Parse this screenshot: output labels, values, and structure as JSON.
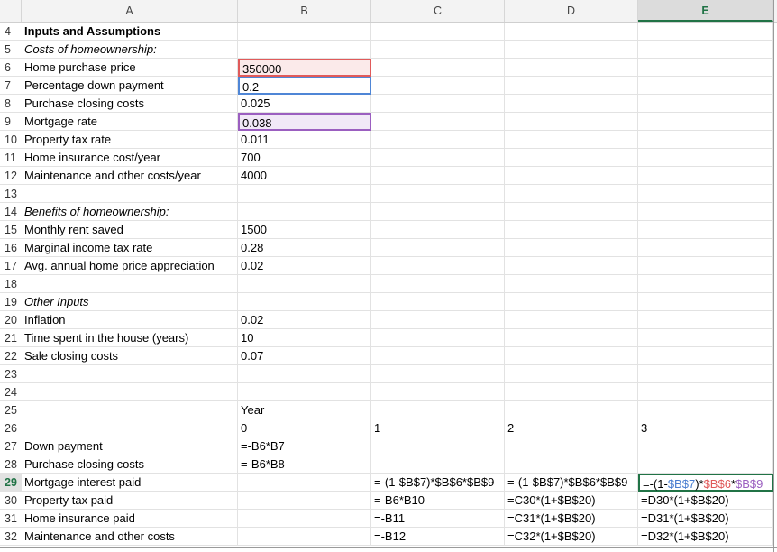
{
  "columns": [
    "A",
    "B",
    "C",
    "D",
    "E"
  ],
  "rows": [
    {
      "num": "4",
      "a": "Inputs and Assumptions",
      "a_style": "bold",
      "b": "",
      "c": "",
      "d": "",
      "e": ""
    },
    {
      "num": "5",
      "a": "Costs of homeownership:",
      "a_style": "ital",
      "b": "",
      "c": "",
      "d": "",
      "e": ""
    },
    {
      "num": "6",
      "a": "Home purchase price",
      "b": "350000",
      "c": "",
      "d": "",
      "e": ""
    },
    {
      "num": "7",
      "a": "Percentage down payment",
      "b": "0.2",
      "c": "",
      "d": "",
      "e": ""
    },
    {
      "num": "8",
      "a": "Purchase closing costs",
      "b": "0.025",
      "c": "",
      "d": "",
      "e": ""
    },
    {
      "num": "9",
      "a": "Mortgage rate",
      "b": "0.038",
      "c": "",
      "d": "",
      "e": ""
    },
    {
      "num": "10",
      "a": "Property tax rate",
      "b": "0.011",
      "c": "",
      "d": "",
      "e": ""
    },
    {
      "num": "11",
      "a": "Home insurance cost/year",
      "b": "700",
      "c": "",
      "d": "",
      "e": ""
    },
    {
      "num": "12",
      "a": "Maintenance and other costs/year",
      "b": "4000",
      "c": "",
      "d": "",
      "e": ""
    },
    {
      "num": "13",
      "a": "",
      "b": "",
      "c": "",
      "d": "",
      "e": ""
    },
    {
      "num": "14",
      "a": "Benefits of homeownership:",
      "a_style": "ital",
      "b": "",
      "c": "",
      "d": "",
      "e": ""
    },
    {
      "num": "15",
      "a": "Monthly rent saved",
      "b": "1500",
      "c": "",
      "d": "",
      "e": ""
    },
    {
      "num": "16",
      "a": "Marginal income tax rate",
      "b": "0.28",
      "c": "",
      "d": "",
      "e": ""
    },
    {
      "num": "17",
      "a": "Avg. annual home price appreciation",
      "b": "0.02",
      "c": "",
      "d": "",
      "e": ""
    },
    {
      "num": "18",
      "a": "",
      "b": "",
      "c": "",
      "d": "",
      "e": ""
    },
    {
      "num": "19",
      "a": "Other Inputs",
      "a_style": "ital",
      "b": "",
      "c": "",
      "d": "",
      "e": ""
    },
    {
      "num": "20",
      "a": "Inflation",
      "b": "0.02",
      "c": "",
      "d": "",
      "e": ""
    },
    {
      "num": "21",
      "a": "Time spent in the house (years)",
      "b": "10",
      "c": "",
      "d": "",
      "e": ""
    },
    {
      "num": "22",
      "a": "Sale closing costs",
      "b": "0.07",
      "c": "",
      "d": "",
      "e": ""
    },
    {
      "num": "23",
      "a": "",
      "b": "",
      "c": "",
      "d": "",
      "e": ""
    },
    {
      "num": "24",
      "a": "",
      "b": "",
      "c": "",
      "d": "",
      "e": ""
    },
    {
      "num": "25",
      "a": "",
      "b": "Year",
      "c": "",
      "d": "",
      "e": ""
    },
    {
      "num": "26",
      "a": "",
      "b": "0",
      "c": "1",
      "d": "2",
      "e": "3"
    },
    {
      "num": "27",
      "a": "Down payment",
      "b": "=-B6*B7",
      "c": "",
      "d": "",
      "e": ""
    },
    {
      "num": "28",
      "a": "Purchase closing costs",
      "b": "=-B6*B8",
      "c": "",
      "d": "",
      "e": ""
    },
    {
      "num": "29",
      "a": "Mortgage interest paid",
      "b": "",
      "c": "=-(1-$B$7)*$B$6*$B$9",
      "d": "=-(1-$B$7)*$B$6*$B$9",
      "e": ""
    },
    {
      "num": "30",
      "a": "Property tax paid",
      "b": "",
      "c": "=-B6*B10",
      "d": "=C30*(1+$B$20)",
      "e": "=D30*(1+$B$20)"
    },
    {
      "num": "31",
      "a": "Home insurance paid",
      "b": "",
      "c": "=-B11",
      "d": "=C31*(1+$B$20)",
      "e": "=D31*(1+$B$20)"
    },
    {
      "num": "32",
      "a": "Maintenance and other costs",
      "b": "",
      "c": "=-B12",
      "d": "=C32*(1+$B$20)",
      "e": "=D32*(1+$B$20)"
    }
  ],
  "active_cell": {
    "ref": "E29",
    "formula_parts": [
      "=-(1-",
      "$B$7",
      ")*",
      "$B$6",
      "*",
      "$B$9"
    ]
  },
  "colors": {
    "accent_green": "#217346",
    "ref_red": "#e05a5a",
    "ref_blue": "#4f86d6",
    "ref_purple": "#9b5fc0"
  }
}
